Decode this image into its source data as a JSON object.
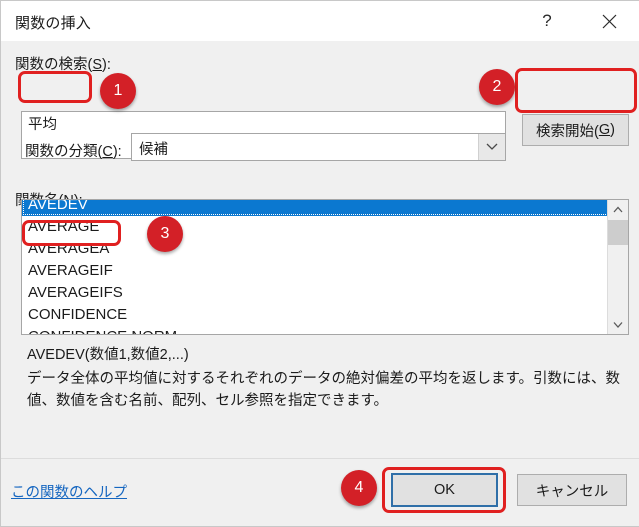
{
  "window": {
    "title": "関数の挿入",
    "help_icon": "question-mark-icon",
    "close_icon": "close-icon"
  },
  "search": {
    "label_text": "関数の検索(",
    "label_accel": "S",
    "label_tail": "):",
    "value": "平均",
    "button_text": "検索開始(",
    "button_accel": "G",
    "button_tail": ")"
  },
  "category": {
    "label_text": "関数の分類(",
    "label_accel": "C",
    "label_tail": "):",
    "value": "候補",
    "arrow_icon": "chevron-down-icon"
  },
  "function_name": {
    "label_text": "関数名(",
    "label_accel": "N",
    "label_tail": "):",
    "items": [
      "AVEDEV",
      "AVERAGE",
      "AVERAGEA",
      "AVERAGEIF",
      "AVERAGEIFS",
      "CONFIDENCE",
      "CONFIDENCE.NORM"
    ],
    "selected": "AVEDEV",
    "scroll_up_icon": "chevron-up-icon",
    "scroll_down_icon": "chevron-down-icon"
  },
  "description": {
    "syntax": "AVEDEV(数値1,数値2,...)",
    "text": "データ全体の平均値に対するそれぞれのデータの絶対偏差の平均を返します。引数には、数値、数値を含む名前、配列、セル参照を指定できます。"
  },
  "footer": {
    "help_link": "この関数のヘルプ",
    "ok_label": "OK",
    "cancel_label": "キャンセル"
  },
  "annotations": {
    "badges": [
      {
        "number": "1"
      },
      {
        "number": "2"
      },
      {
        "number": "3"
      },
      {
        "number": "4"
      }
    ],
    "accent_color": "#d32027",
    "box_color": "#e02020"
  },
  "colors": {
    "selection_blue": "#0b78d0",
    "link_blue": "#1566c0",
    "focus_border": "#2f6fa8",
    "dialog_background": "#f0f0f0"
  }
}
